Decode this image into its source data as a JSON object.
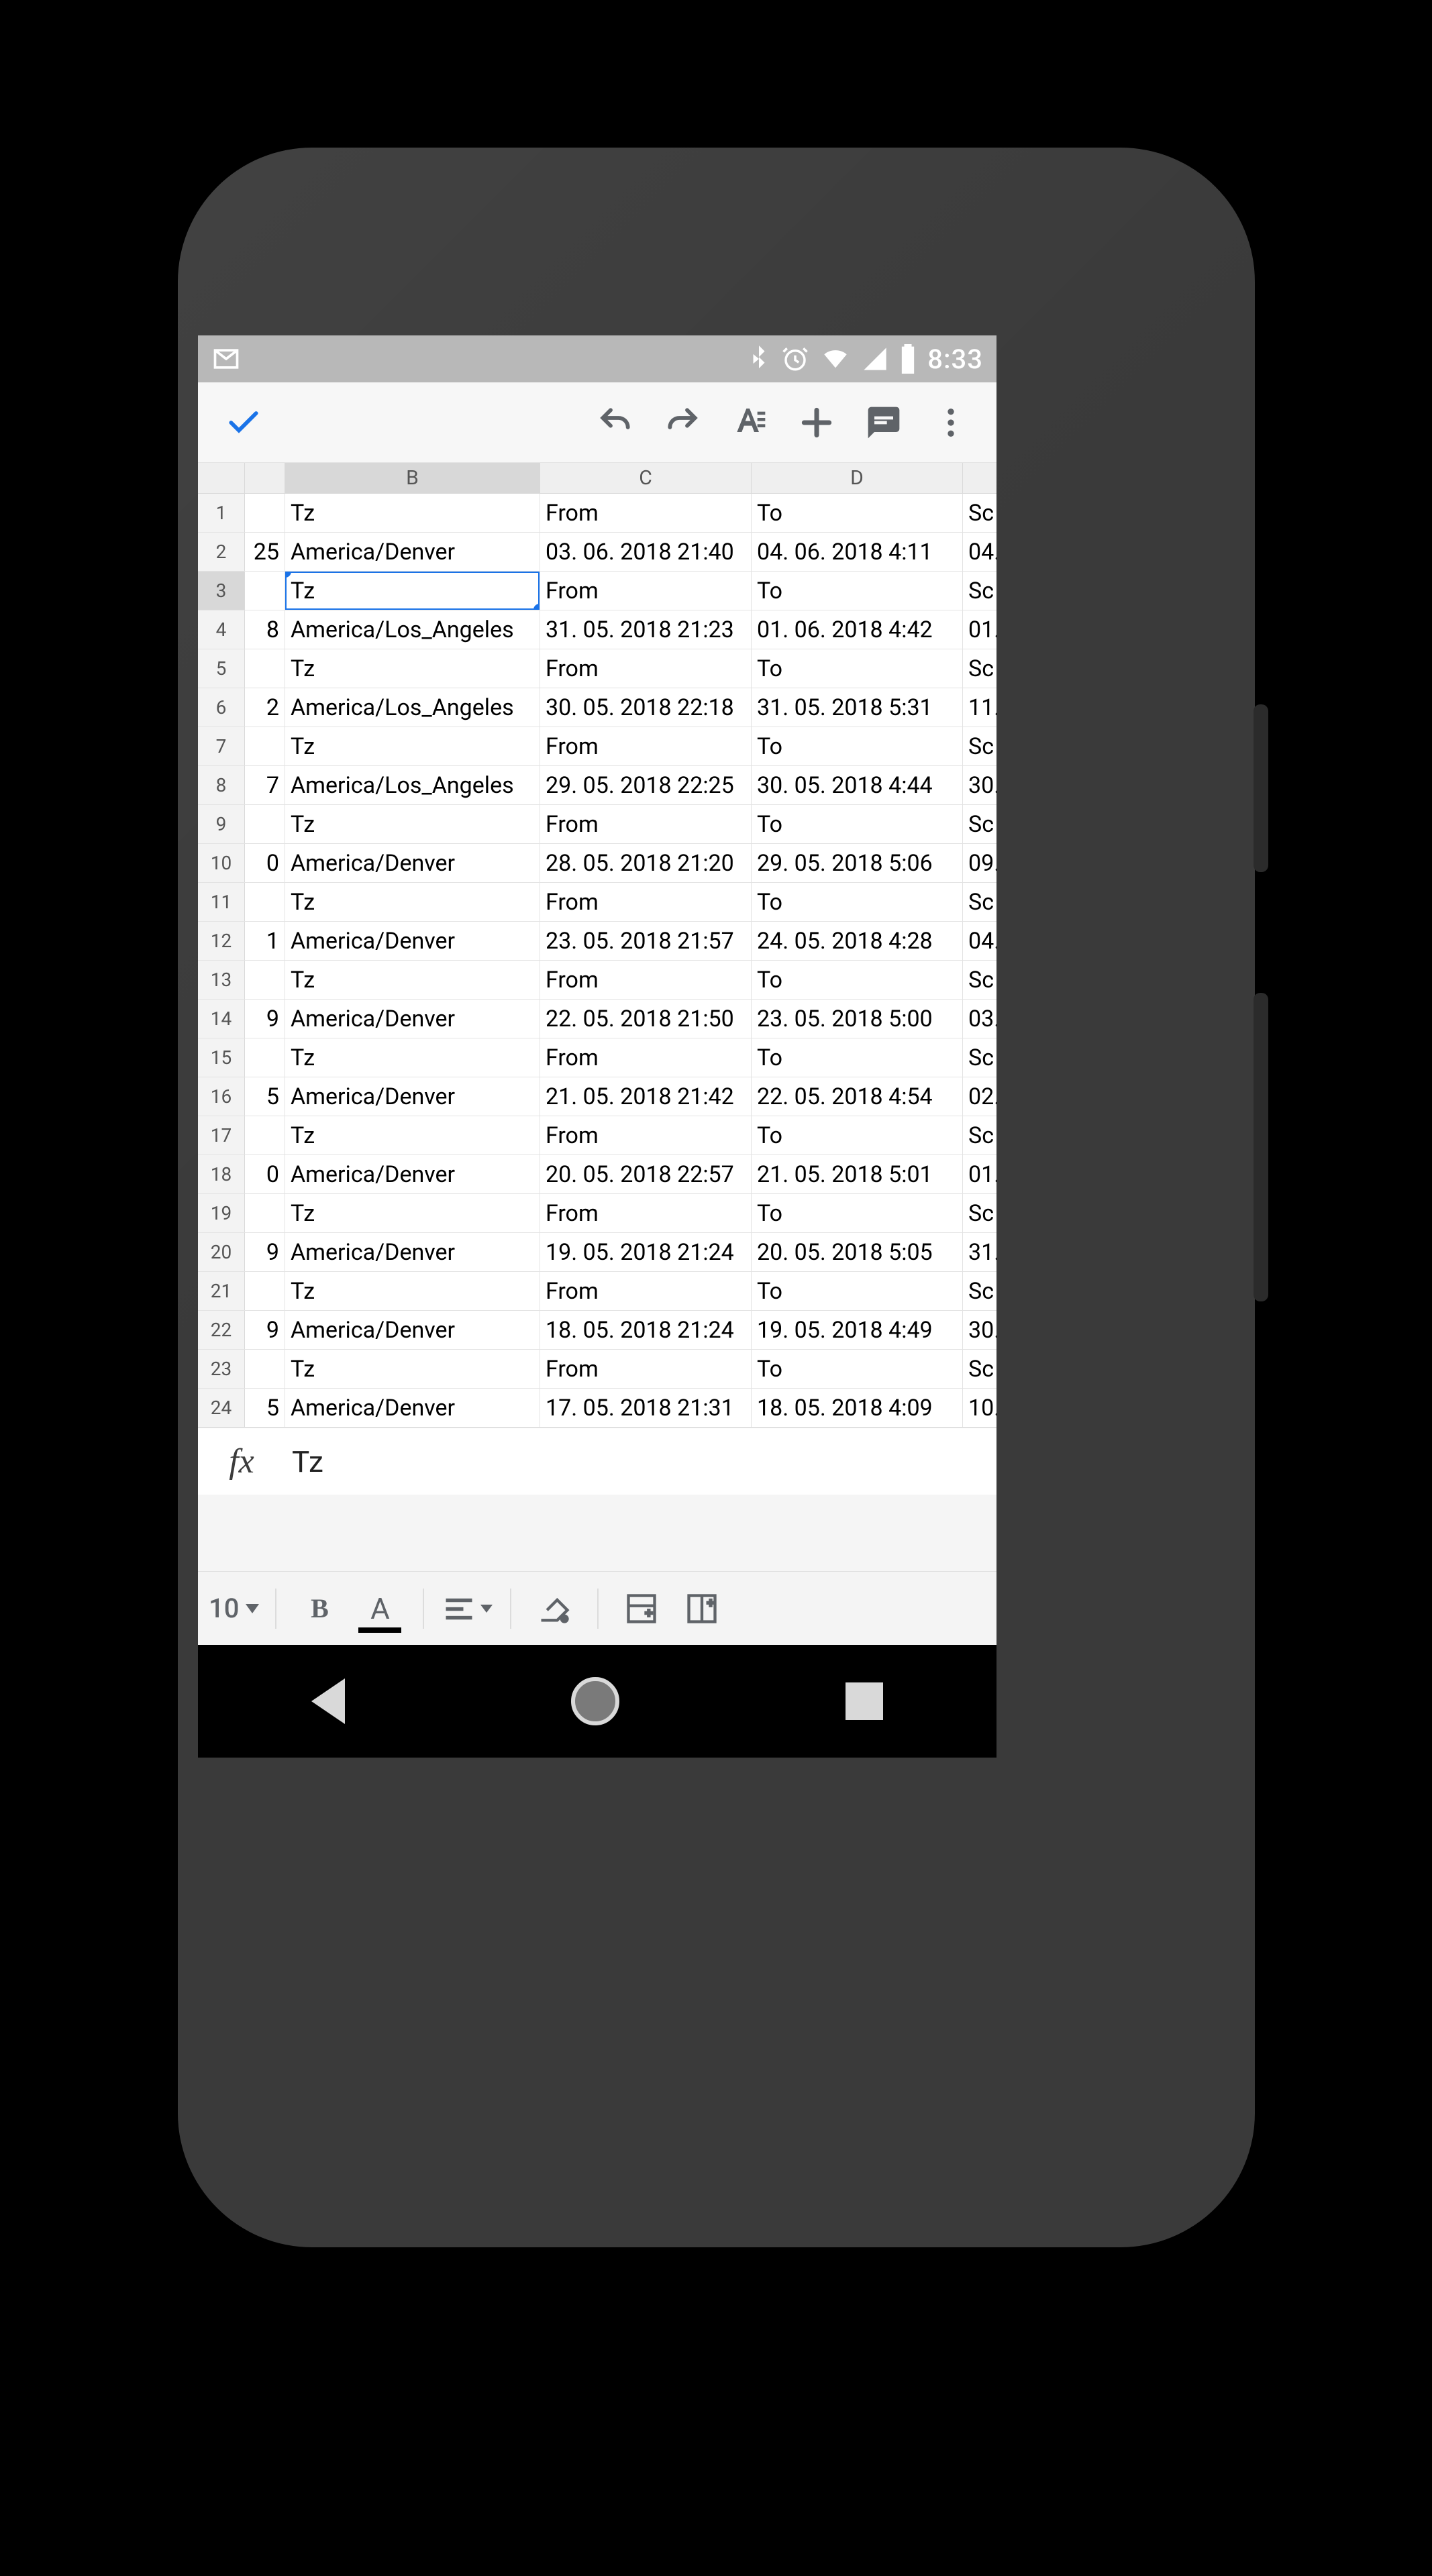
{
  "status": {
    "time": "8:33",
    "icons": [
      "gmail",
      "bluetooth",
      "alarm",
      "wifi",
      "cell",
      "battery"
    ]
  },
  "toolbar": {
    "accept": "accept",
    "undo": "undo",
    "redo": "redo",
    "format_text": "text-format",
    "insert": "insert",
    "comment": "comment",
    "more": "more"
  },
  "columns": {
    "A": "",
    "B": "B",
    "C": "C",
    "D": "D",
    "E": ""
  },
  "active_cell": {
    "row": 3,
    "col": "B"
  },
  "formula_bar": {
    "label": "fx",
    "value": "Tz"
  },
  "rows": [
    {
      "n": 1,
      "A": "",
      "B": "Tz",
      "C": "From",
      "D": "To",
      "E": "Sc"
    },
    {
      "n": 2,
      "A": "25",
      "B": "America/Denver",
      "C": "03. 06. 2018 21:40",
      "D": "04. 06. 2018 4:11",
      "E": "04."
    },
    {
      "n": 3,
      "A": "",
      "B": "Tz",
      "C": "From",
      "D": "To",
      "E": "Sc"
    },
    {
      "n": 4,
      "A": "8",
      "B": "America/Los_Angeles",
      "C": "31. 05. 2018 21:23",
      "D": "01. 06. 2018 4:42",
      "E": "01."
    },
    {
      "n": 5,
      "A": "",
      "B": "Tz",
      "C": "From",
      "D": "To",
      "E": "Sc"
    },
    {
      "n": 6,
      "A": "2",
      "B": "America/Los_Angeles",
      "C": "30. 05. 2018 22:18",
      "D": "31. 05. 2018 5:31",
      "E": "11."
    },
    {
      "n": 7,
      "A": "",
      "B": "Tz",
      "C": "From",
      "D": "To",
      "E": "Sc"
    },
    {
      "n": 8,
      "A": "7",
      "B": "America/Los_Angeles",
      "C": "29. 05. 2018 22:25",
      "D": "30. 05. 2018 4:44",
      "E": "30."
    },
    {
      "n": 9,
      "A": "",
      "B": "Tz",
      "C": "From",
      "D": "To",
      "E": "Sc"
    },
    {
      "n": 10,
      "A": "0",
      "B": "America/Denver",
      "C": "28. 05. 2018 21:20",
      "D": "29. 05. 2018 5:06",
      "E": "09."
    },
    {
      "n": 11,
      "A": "",
      "B": "Tz",
      "C": "From",
      "D": "To",
      "E": "Sc"
    },
    {
      "n": 12,
      "A": "1",
      "B": "America/Denver",
      "C": "23. 05. 2018 21:57",
      "D": "24. 05. 2018 4:28",
      "E": "04."
    },
    {
      "n": 13,
      "A": "",
      "B": "Tz",
      "C": "From",
      "D": "To",
      "E": "Sc"
    },
    {
      "n": 14,
      "A": "9",
      "B": "America/Denver",
      "C": "22. 05. 2018 21:50",
      "D": "23. 05. 2018 5:00",
      "E": "03."
    },
    {
      "n": 15,
      "A": "",
      "B": "Tz",
      "C": "From",
      "D": "To",
      "E": "Sc"
    },
    {
      "n": 16,
      "A": "5",
      "B": "America/Denver",
      "C": "21. 05. 2018 21:42",
      "D": "22. 05. 2018 4:54",
      "E": "02."
    },
    {
      "n": 17,
      "A": "",
      "B": "Tz",
      "C": "From",
      "D": "To",
      "E": "Sc"
    },
    {
      "n": 18,
      "A": "0",
      "B": "America/Denver",
      "C": "20. 05. 2018 22:57",
      "D": "21. 05. 2018 5:01",
      "E": "01."
    },
    {
      "n": 19,
      "A": "",
      "B": "Tz",
      "C": "From",
      "D": "To",
      "E": "Sc"
    },
    {
      "n": 20,
      "A": "9",
      "B": "America/Denver",
      "C": "19. 05. 2018 21:24",
      "D": "20. 05. 2018 5:05",
      "E": "31."
    },
    {
      "n": 21,
      "A": "",
      "B": "Tz",
      "C": "From",
      "D": "To",
      "E": "Sc"
    },
    {
      "n": 22,
      "A": "9",
      "B": "America/Denver",
      "C": "18. 05. 2018 21:24",
      "D": "19. 05. 2018 4:49",
      "E": "30."
    },
    {
      "n": 23,
      "A": "",
      "B": "Tz",
      "C": "From",
      "D": "To",
      "E": "Sc"
    },
    {
      "n": 24,
      "A": "5",
      "B": "America/Denver",
      "C": "17. 05. 2018 21:31",
      "D": "18. 05. 2018 4:09",
      "E": "10."
    }
  ],
  "format_bar": {
    "font_size": "10",
    "bold": "B",
    "text_color": "A"
  },
  "nav": {
    "back": "back",
    "home": "home",
    "recents": "recents"
  },
  "colors": {
    "accent": "#1a73e8",
    "toolbar_icon": "#5f6368"
  }
}
